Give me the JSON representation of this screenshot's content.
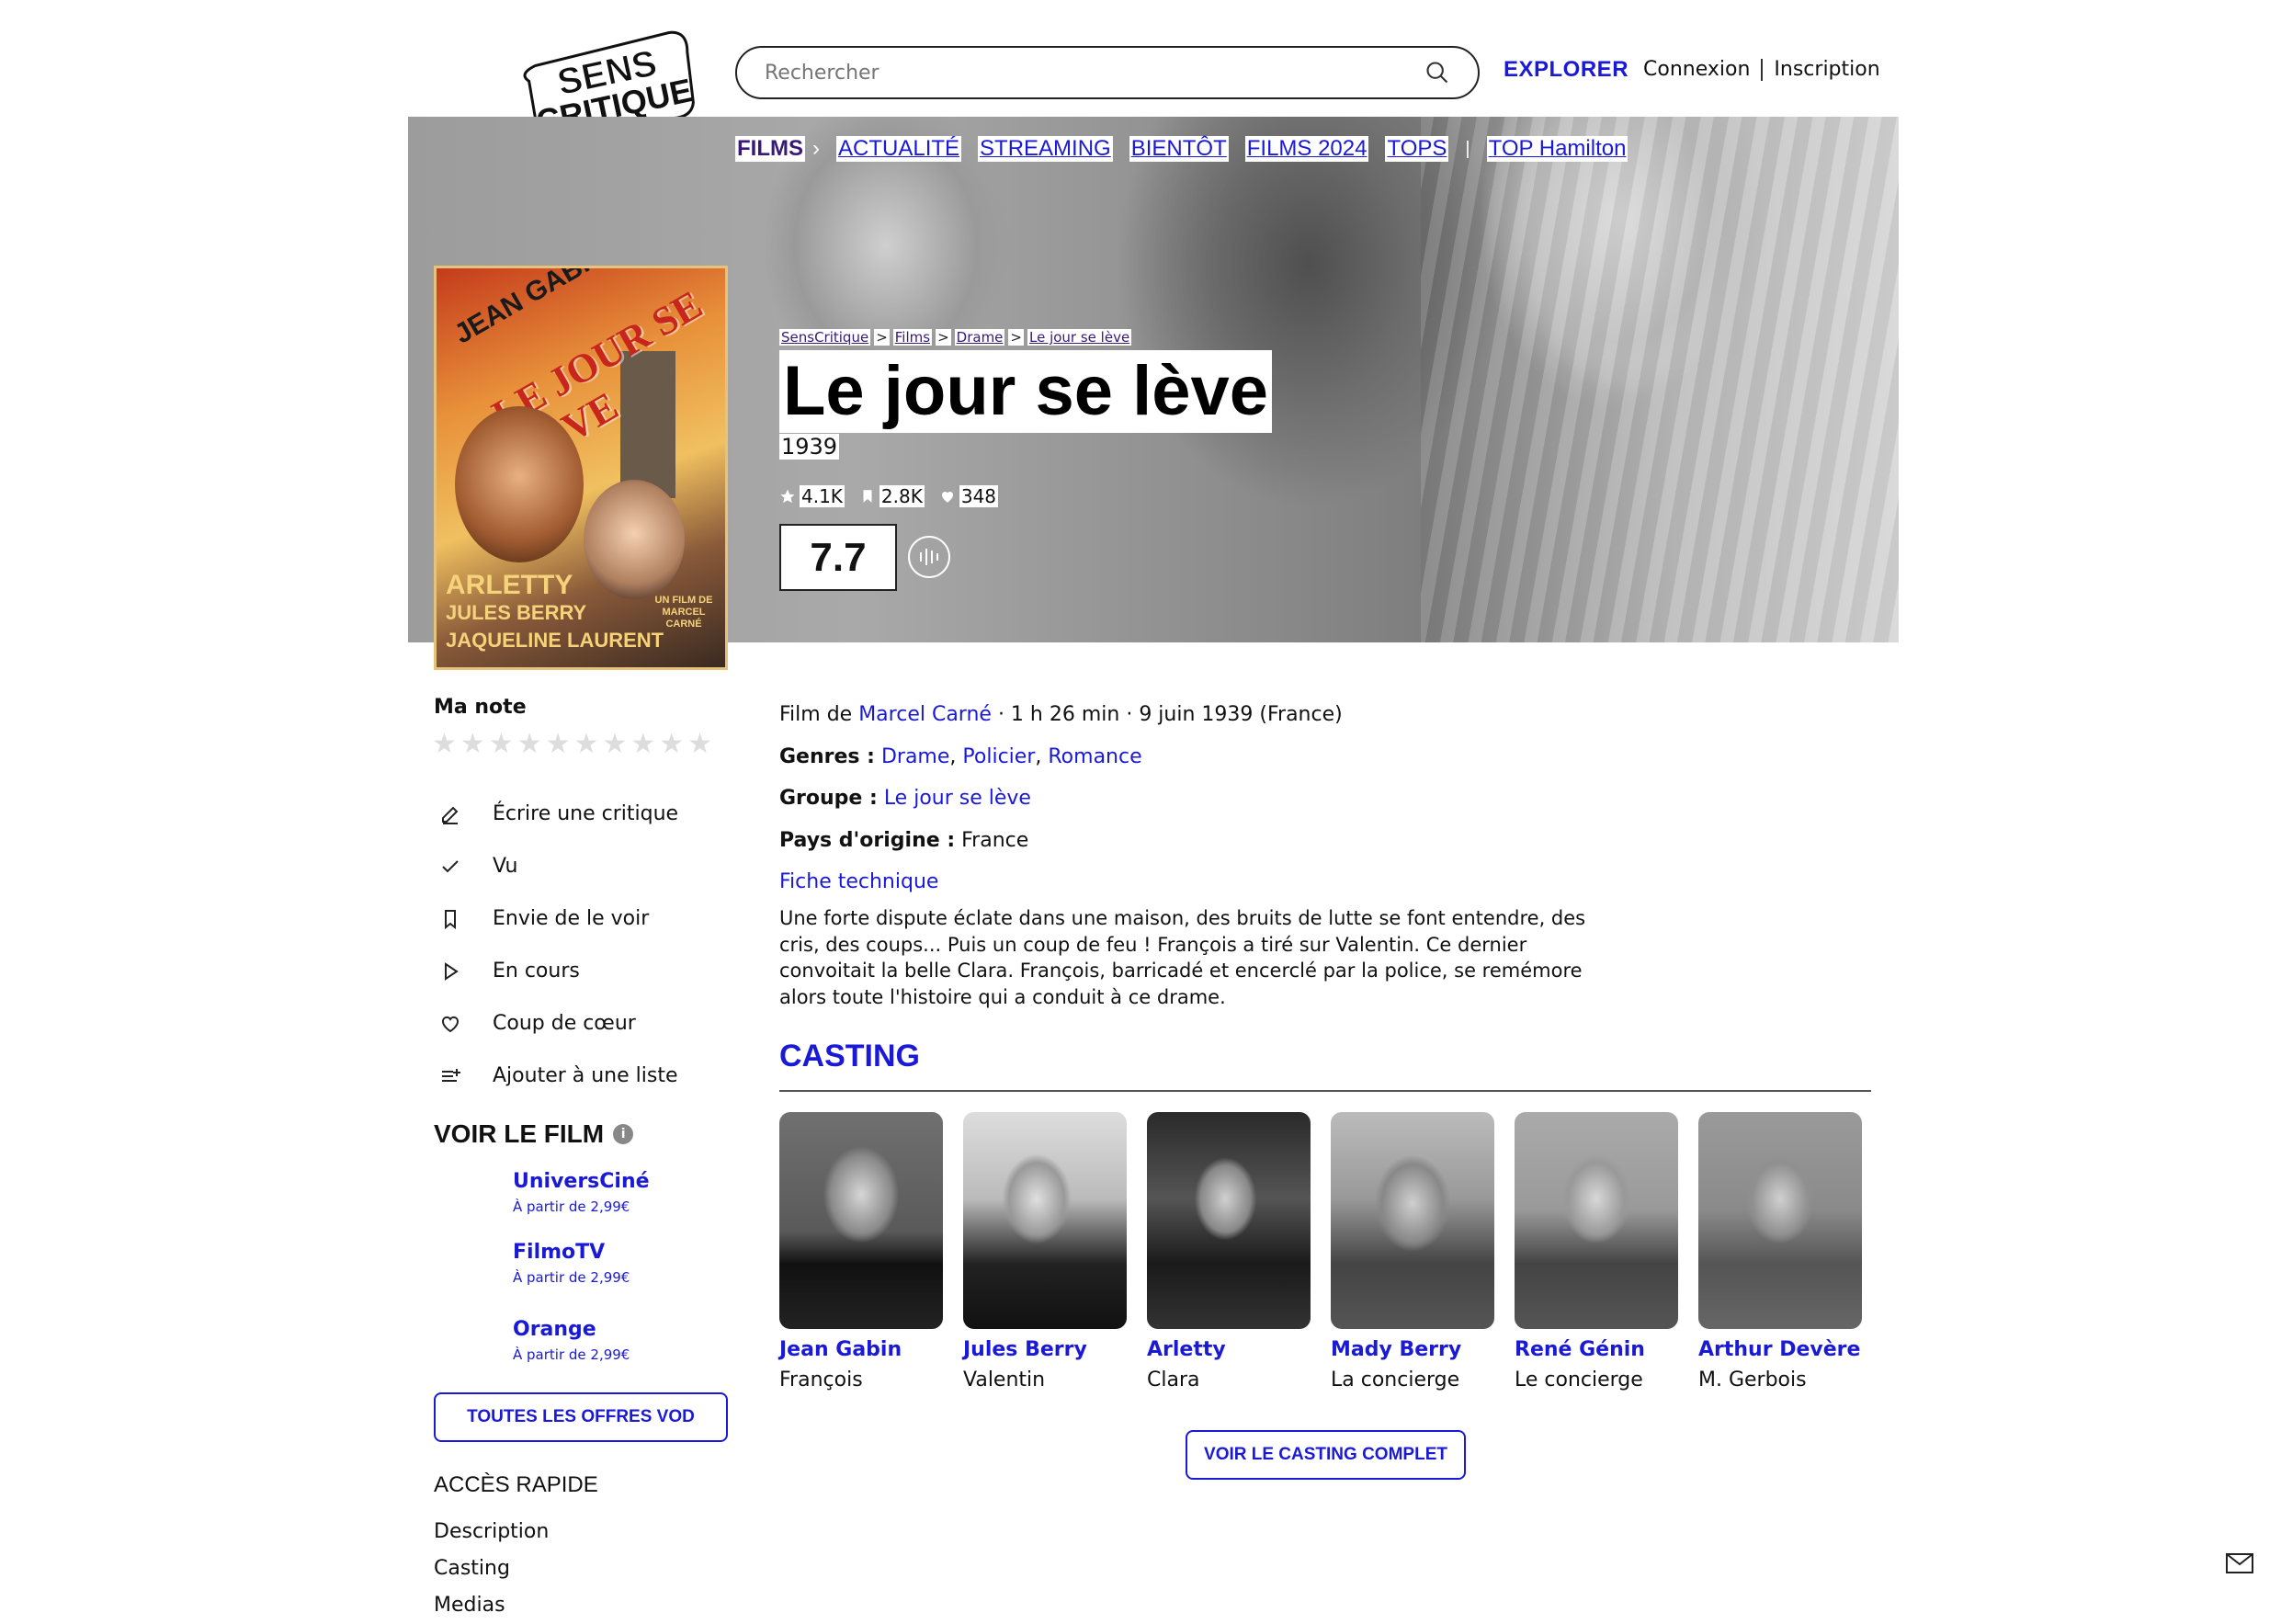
{
  "header": {
    "logo_line1": "SENS",
    "logo_line2": "CRITIQUE",
    "search_placeholder": "Rechercher",
    "explorer": "EXPLORER",
    "login": "Connexion",
    "signup": "Inscription"
  },
  "nav": {
    "films": "FILMS",
    "items": [
      "ACTUALITÉ",
      "STREAMING",
      "BIENTÔT",
      "FILMS 2024",
      "TOPS"
    ],
    "extra": "TOP Hamilton"
  },
  "poster": {
    "actor": "JEAN GABIN",
    "title": "LE JOUR SE LÈVE",
    "cast1": "ARLETTY",
    "cast2": "JULES BERRY",
    "cast3": "JAQUELINE LAURENT",
    "director": "UN FILM DE MARCEL CARNÉ"
  },
  "breadcrumb": [
    "SensCritique",
    "Films",
    "Drame",
    "Le jour se lève"
  ],
  "film": {
    "title": "Le jour se lève",
    "year": "1939",
    "stats": {
      "ratings": "4.1K",
      "wishlist": "2.8K",
      "favorites": "348"
    },
    "score": "7.7"
  },
  "left": {
    "my_rating": "Ma note",
    "actions": [
      {
        "icon": "pencil-icon",
        "label": "Écrire une critique"
      },
      {
        "icon": "check-icon",
        "label": "Vu"
      },
      {
        "icon": "bookmark-icon",
        "label": "Envie de le voir"
      },
      {
        "icon": "play-icon",
        "label": "En cours"
      },
      {
        "icon": "heart-icon",
        "label": "Coup de cœur"
      },
      {
        "icon": "list-add-icon",
        "label": "Ajouter à une liste"
      }
    ],
    "watch_title": "VOIR LE FILM",
    "providers": [
      {
        "name": "UniversCiné",
        "price": "À partir de 2,99€"
      },
      {
        "name": "FilmoTV",
        "price": "À partir de 2,99€"
      },
      {
        "name": "Orange",
        "price": "À partir de 2,99€"
      }
    ],
    "vod_button": "TOUTES LES OFFRES VOD",
    "quick_title": "ACCÈS RAPIDE",
    "quick_links": [
      "Description",
      "Casting",
      "Medias"
    ]
  },
  "details": {
    "film_by": "Film de",
    "director": "Marcel Carné",
    "meta": " · 1 h 26 min · 9 juin 1939 (France)",
    "genres_label": "Genres :",
    "genres": [
      "Drame",
      "Policier",
      "Romance"
    ],
    "group_label": "Groupe :",
    "group": "Le jour se lève",
    "country_label": "Pays d'origine :",
    "country": "France",
    "tech_sheet": "Fiche technique",
    "synopsis": "Une forte dispute éclate dans une maison, des bruits de lutte se font entendre, des cris, des coups... Puis un coup de feu ! François a tiré sur Valentin. Ce dernier convoitait la belle Clara. François, barricadé et encerclé par la police, se remémore alors toute l'histoire qui a conduit à ce drame."
  },
  "casting": {
    "title": "CASTING",
    "members": [
      {
        "name": "Jean Gabin",
        "role": "François"
      },
      {
        "name": "Jules Berry",
        "role": "Valentin"
      },
      {
        "name": "Arletty",
        "role": "Clara"
      },
      {
        "name": "Mady Berry",
        "role": "La concierge"
      },
      {
        "name": "René Génin",
        "role": "Le concierge"
      },
      {
        "name": "Arthur Devère",
        "role": "M. Gerbois"
      }
    ],
    "button": "VOIR LE CASTING COMPLET"
  }
}
